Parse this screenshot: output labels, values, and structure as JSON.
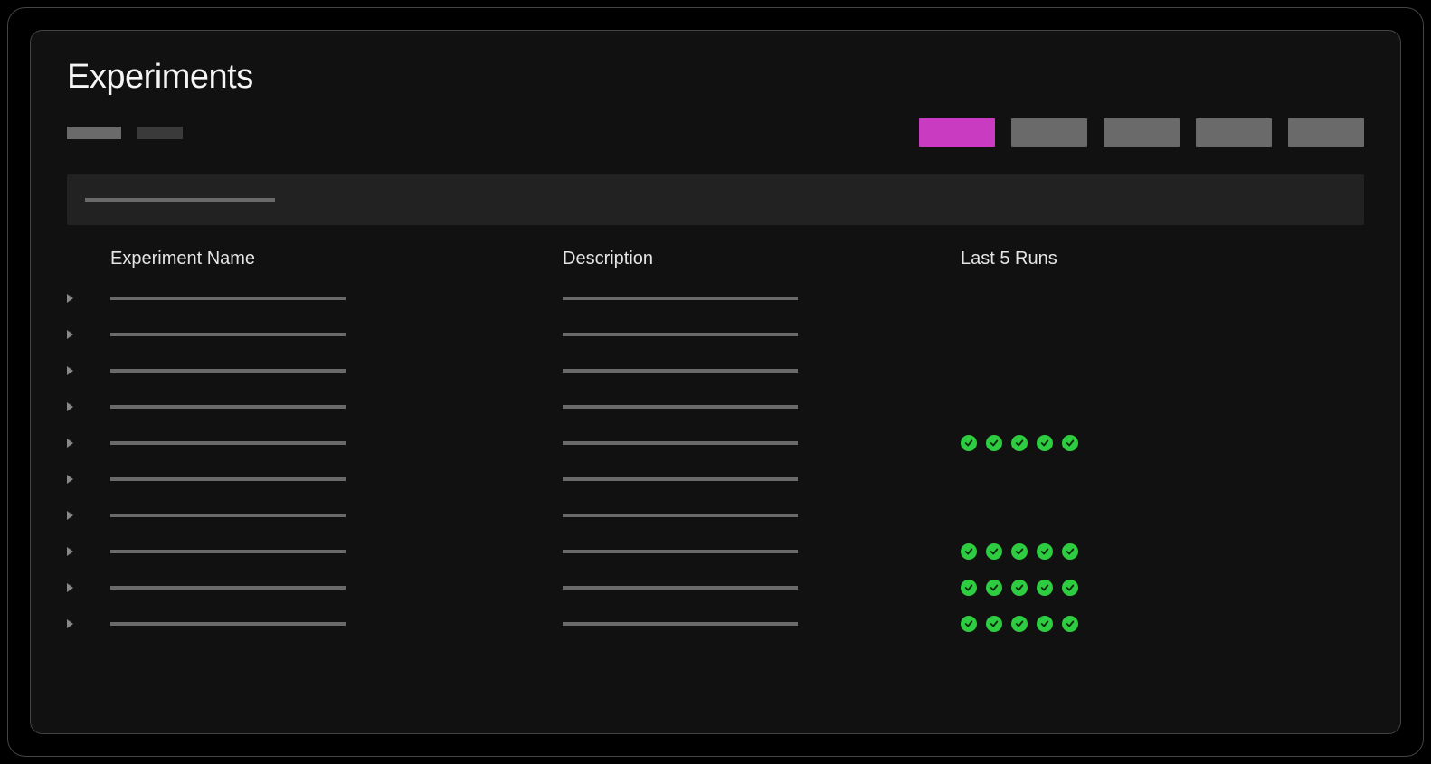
{
  "title": "Experiments",
  "colors": {
    "accent": "#c93bc0",
    "success": "#2ecc40"
  },
  "toolbar": {
    "left_chips": [
      {
        "active": true
      },
      {
        "active": false
      }
    ],
    "right_buttons": [
      {
        "active": true
      },
      {
        "active": false
      },
      {
        "active": false
      },
      {
        "active": false
      },
      {
        "active": false
      }
    ]
  },
  "search": {
    "placeholder": ""
  },
  "columns": {
    "name": "Experiment Name",
    "description": "Description",
    "last_runs": "Last 5 Runs"
  },
  "rows": [
    {
      "name": "",
      "description": "",
      "runs": []
    },
    {
      "name": "",
      "description": "",
      "runs": []
    },
    {
      "name": "",
      "description": "",
      "runs": []
    },
    {
      "name": "",
      "description": "",
      "runs": []
    },
    {
      "name": "",
      "description": "",
      "runs": [
        "success",
        "success",
        "success",
        "success",
        "success"
      ]
    },
    {
      "name": "",
      "description": "",
      "runs": []
    },
    {
      "name": "",
      "description": "",
      "runs": []
    },
    {
      "name": "",
      "description": "",
      "runs": [
        "success",
        "success",
        "success",
        "success",
        "success"
      ]
    },
    {
      "name": "",
      "description": "",
      "runs": [
        "success",
        "success",
        "success",
        "success",
        "success"
      ]
    },
    {
      "name": "",
      "description": "",
      "runs": [
        "success",
        "success",
        "success",
        "success",
        "success"
      ]
    }
  ]
}
